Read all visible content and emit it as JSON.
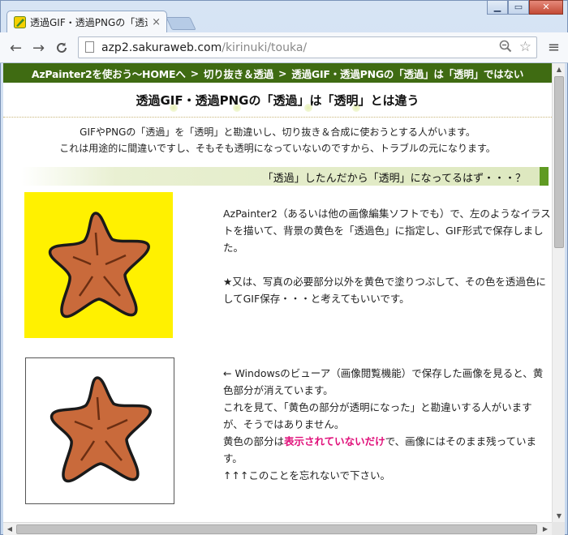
{
  "window": {
    "minimize": "▁",
    "restore": "▭",
    "close": "✕"
  },
  "tab": {
    "title": "透過GIF・透過PNGの「透過」",
    "close": "×",
    "favicon": "azpainter-favicon"
  },
  "toolbar": {
    "back": "←",
    "forward": "→",
    "reload": "C",
    "url_host": "azp2.sakuraweb.com",
    "url_path": "/kirinuki/touka/",
    "zoom": "⊖",
    "star": "☆",
    "menu": "≡"
  },
  "page": {
    "breadcrumb": {
      "item1": "AzPainter2を使おう～HOMEへ",
      "sep1": ">",
      "item2": "切り抜き＆透過",
      "sep2": ">",
      "item3": "透過GIF・透過PNGの「透過」は「透明」ではない"
    },
    "headline": "透過GIF・透過PNGの「透過」は「透明」とは違う",
    "intro": {
      "line1": "GIFやPNGの「透過」を「透明」と勘違いし、切り抜き＆合成に使おうとする人がいます。",
      "line2": "これは用途的に間違いですし、そもそも透明になっていないのですから、トラブルの元になります。"
    },
    "section_heading": "「透過」したんだから「透明」になってるはず・・・？",
    "para1": {
      "text": "AzPainter2（あるいは他の画像編集ソフトでも）で、左のようなイラストを描いて、背景の黄色を「透過色」に指定し、GIF形式で保存しました。",
      "note": "★又は、写真の必要部分以外を黄色で塗りつぶして、その色を透過色にしてGIF保存・・・と考えてもいいです。"
    },
    "para2": {
      "line1": "← Windowsのビューア（画像閲覧機能）で保存した画像を見ると、黄色部分が消えています。",
      "line2": "これを見て、「黄色の部分が透明になった」と勘違いする人がいますが、そうではありません。",
      "line3a": "黄色の部分は",
      "line3emph": "表示されていないだけ",
      "line3b": "で、画像にはそのまま残っています。",
      "line4": "↑↑↑このことを忘れないで下さい。"
    },
    "colors": {
      "breadcrumb_bg": "#3f6b12",
      "yellow_bg": "#fff100",
      "star_fill": "#c96a3b",
      "emphasis": "#e0107a"
    }
  }
}
